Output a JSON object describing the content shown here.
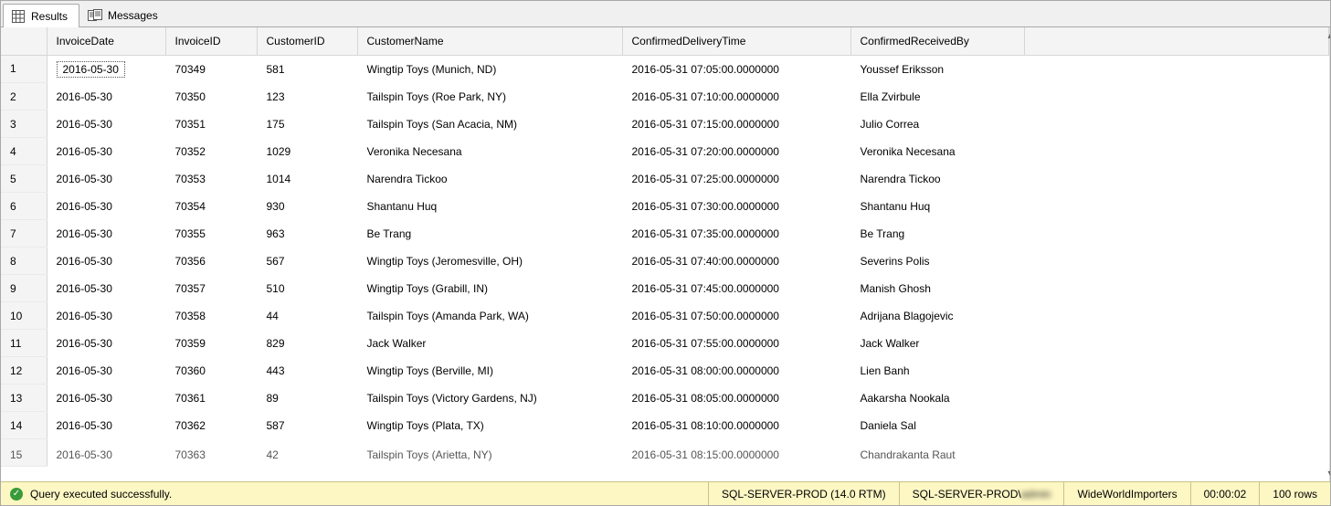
{
  "tabs": {
    "results": "Results",
    "messages": "Messages"
  },
  "columns": {
    "invoice_date": "InvoiceDate",
    "invoice_id": "InvoiceID",
    "customer_id": "CustomerID",
    "customer_name": "CustomerName",
    "confirmed_delivery_time": "ConfirmedDeliveryTime",
    "confirmed_received_by": "ConfirmedReceivedBy"
  },
  "rows": [
    {
      "n": "1",
      "date": "2016-05-30",
      "inv": "70349",
      "cust": "581",
      "name": "Wingtip Toys (Munich, ND)",
      "time": "2016-05-31 07:05:00.0000000",
      "recv": "Youssef Eriksson"
    },
    {
      "n": "2",
      "date": "2016-05-30",
      "inv": "70350",
      "cust": "123",
      "name": "Tailspin Toys (Roe Park, NY)",
      "time": "2016-05-31 07:10:00.0000000",
      "recv": "Ella Zvirbule"
    },
    {
      "n": "3",
      "date": "2016-05-30",
      "inv": "70351",
      "cust": "175",
      "name": "Tailspin Toys (San Acacia, NM)",
      "time": "2016-05-31 07:15:00.0000000",
      "recv": "Julio Correa"
    },
    {
      "n": "4",
      "date": "2016-05-30",
      "inv": "70352",
      "cust": "1029",
      "name": "Veronika Necesana",
      "time": "2016-05-31 07:20:00.0000000",
      "recv": "Veronika Necesana"
    },
    {
      "n": "5",
      "date": "2016-05-30",
      "inv": "70353",
      "cust": "1014",
      "name": "Narendra Tickoo",
      "time": "2016-05-31 07:25:00.0000000",
      "recv": "Narendra Tickoo"
    },
    {
      "n": "6",
      "date": "2016-05-30",
      "inv": "70354",
      "cust": "930",
      "name": "Shantanu Huq",
      "time": "2016-05-31 07:30:00.0000000",
      "recv": "Shantanu Huq"
    },
    {
      "n": "7",
      "date": "2016-05-30",
      "inv": "70355",
      "cust": "963",
      "name": "Be Trang",
      "time": "2016-05-31 07:35:00.0000000",
      "recv": "Be Trang"
    },
    {
      "n": "8",
      "date": "2016-05-30",
      "inv": "70356",
      "cust": "567",
      "name": "Wingtip Toys (Jeromesville, OH)",
      "time": "2016-05-31 07:40:00.0000000",
      "recv": "Severins Polis"
    },
    {
      "n": "9",
      "date": "2016-05-30",
      "inv": "70357",
      "cust": "510",
      "name": "Wingtip Toys (Grabill, IN)",
      "time": "2016-05-31 07:45:00.0000000",
      "recv": "Manish Ghosh"
    },
    {
      "n": "10",
      "date": "2016-05-30",
      "inv": "70358",
      "cust": "44",
      "name": "Tailspin Toys (Amanda Park, WA)",
      "time": "2016-05-31 07:50:00.0000000",
      "recv": "Adrijana Blagojevic"
    },
    {
      "n": "11",
      "date": "2016-05-30",
      "inv": "70359",
      "cust": "829",
      "name": "Jack Walker",
      "time": "2016-05-31 07:55:00.0000000",
      "recv": "Jack Walker"
    },
    {
      "n": "12",
      "date": "2016-05-30",
      "inv": "70360",
      "cust": "443",
      "name": "Wingtip Toys (Berville, MI)",
      "time": "2016-05-31 08:00:00.0000000",
      "recv": "Lien Banh"
    },
    {
      "n": "13",
      "date": "2016-05-30",
      "inv": "70361",
      "cust": "89",
      "name": "Tailspin Toys (Victory Gardens, NJ)",
      "time": "2016-05-31 08:05:00.0000000",
      "recv": "Aakarsha Nookala"
    },
    {
      "n": "14",
      "date": "2016-05-30",
      "inv": "70362",
      "cust": "587",
      "name": "Wingtip Toys (Plata, TX)",
      "time": "2016-05-31 08:10:00.0000000",
      "recv": "Daniela Sal"
    },
    {
      "n": "15",
      "date": "2016-05-30",
      "inv": "70363",
      "cust": "42",
      "name": "Tailspin Toys (Arietta, NY)",
      "time": "2016-05-31 08:15:00.0000000",
      "recv": "Chandrakanta Raut"
    }
  ],
  "status": {
    "message": "Query executed successfully.",
    "server": "SQL-SERVER-PROD (14.0 RTM)",
    "login_prefix": "SQL-SERVER-PROD\\",
    "login_user": "admin",
    "database": "WideWorldImporters",
    "elapsed": "00:00:02",
    "rowcount": "100 rows"
  }
}
